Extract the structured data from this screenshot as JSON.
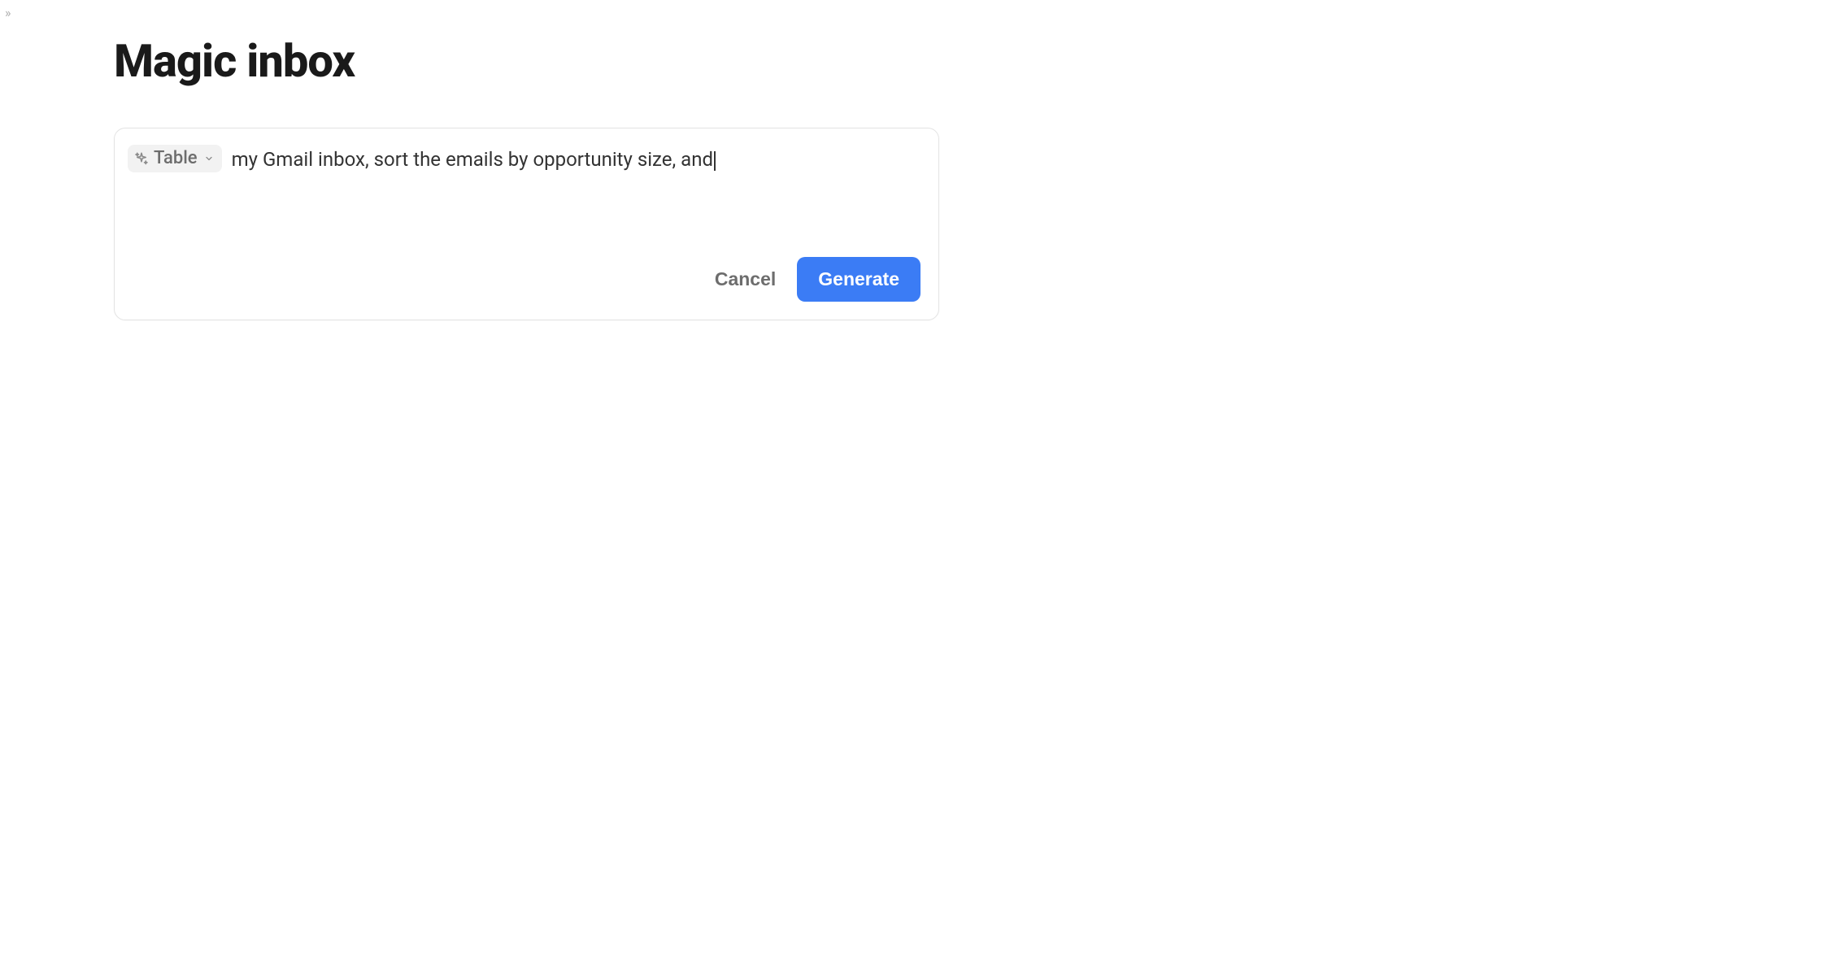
{
  "header": {
    "title": "Magic inbox"
  },
  "prompt": {
    "mode_chip_label": "Table",
    "input_text": "my Gmail inbox, sort the emails by opportunity size, and"
  },
  "actions": {
    "cancel_label": "Cancel",
    "generate_label": "Generate"
  },
  "collapse_glyph": "»"
}
